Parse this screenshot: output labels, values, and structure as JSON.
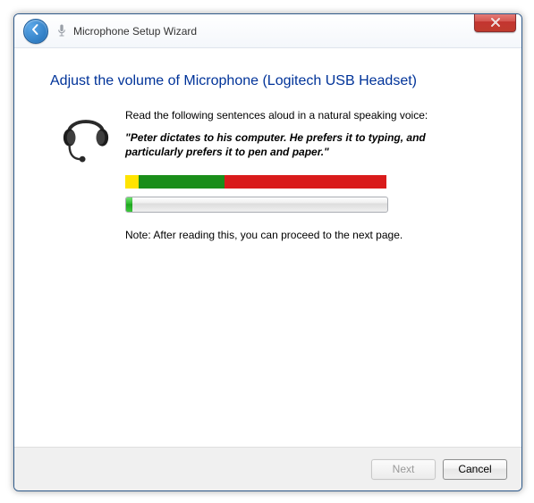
{
  "window": {
    "title": "Microphone Setup Wizard"
  },
  "page": {
    "heading": "Adjust the volume of Microphone (Logitech USB Headset)",
    "instruction": "Read the following sentences aloud in a natural speaking voice:",
    "quote": "\"Peter dictates to his computer. He prefers it to typing, and particularly prefers it to pen and paper.\"",
    "note": "Note: After reading this, you can proceed to the next page."
  },
  "meter": {
    "yellow_pct": 5,
    "green_pct": 33,
    "red_pct": 62
  },
  "progress": {
    "percent": 2
  },
  "buttons": {
    "next": "Next",
    "cancel": "Cancel"
  }
}
